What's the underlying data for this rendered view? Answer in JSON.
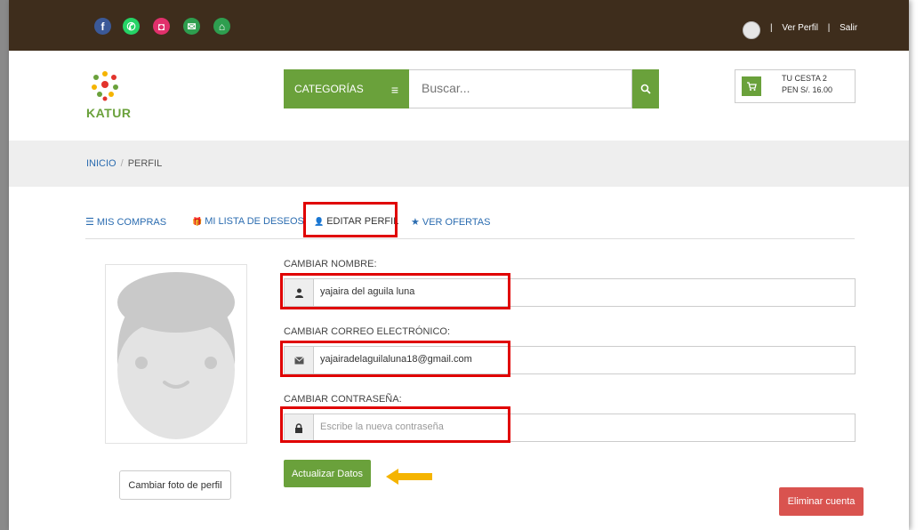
{
  "colors": {
    "topbar": "#3e2d1c",
    "brand_green": "#6aa13b",
    "link_blue": "#2b6cb0",
    "highlight_red": "#e00000",
    "danger": "#d9534f",
    "arrow": "#f5b400"
  },
  "social_icons": [
    {
      "name": "facebook-icon",
      "glyph": "f",
      "color": "#3b5998"
    },
    {
      "name": "whatsapp-icon",
      "glyph": "✆",
      "color": "#25d366"
    },
    {
      "name": "instagram-icon",
      "glyph": "◘",
      "color": "#e1306c"
    },
    {
      "name": "mail-icon",
      "glyph": "✉",
      "color": "#2e9e4f"
    },
    {
      "name": "home-icon",
      "glyph": "⌂",
      "color": "#2e9e4f"
    }
  ],
  "top_links": {
    "separator": "|",
    "view_profile": "Ver Perfil",
    "logout": "Salir"
  },
  "header": {
    "logo_text": "KATUR",
    "categories_label": "CATEGORÍAS",
    "categories_icon": "≡",
    "search_placeholder": "Buscar...",
    "search_icon": "search-icon",
    "cart_icon": "cart-icon",
    "cart_line1": "TU CESTA 2",
    "cart_line2": "PEN S/. 16.00"
  },
  "breadcrumb": {
    "home": "INICIO",
    "separator": "/",
    "current": "PERFIL"
  },
  "tabs": [
    {
      "label": "MIS COMPRAS",
      "icon": "list-icon",
      "glyph": "☰"
    },
    {
      "label": "MI LISTA DE DESEOS",
      "icon": "gift-icon",
      "glyph": "🎁"
    },
    {
      "label": "EDITAR PERFIL",
      "icon": "user-icon",
      "glyph": "👤"
    },
    {
      "label": "VER OFERTAS",
      "icon": "star-icon",
      "glyph": "★"
    }
  ],
  "form": {
    "name_label": "CAMBIAR NOMBRE:",
    "name_value": "yajaira del aguila luna",
    "email_label": "CAMBIAR CORREO ELECTRÓNICO:",
    "email_value": "yajairadelaguilaluna18@gmail.com",
    "password_label": "CAMBIAR CONTRASEÑA:",
    "password_placeholder": "Escribe la nueva contraseña",
    "update_button": "Actualizar Datos"
  },
  "change_photo_button": "Cambiar foto de perfil",
  "delete_account_button": "Eliminar cuenta"
}
